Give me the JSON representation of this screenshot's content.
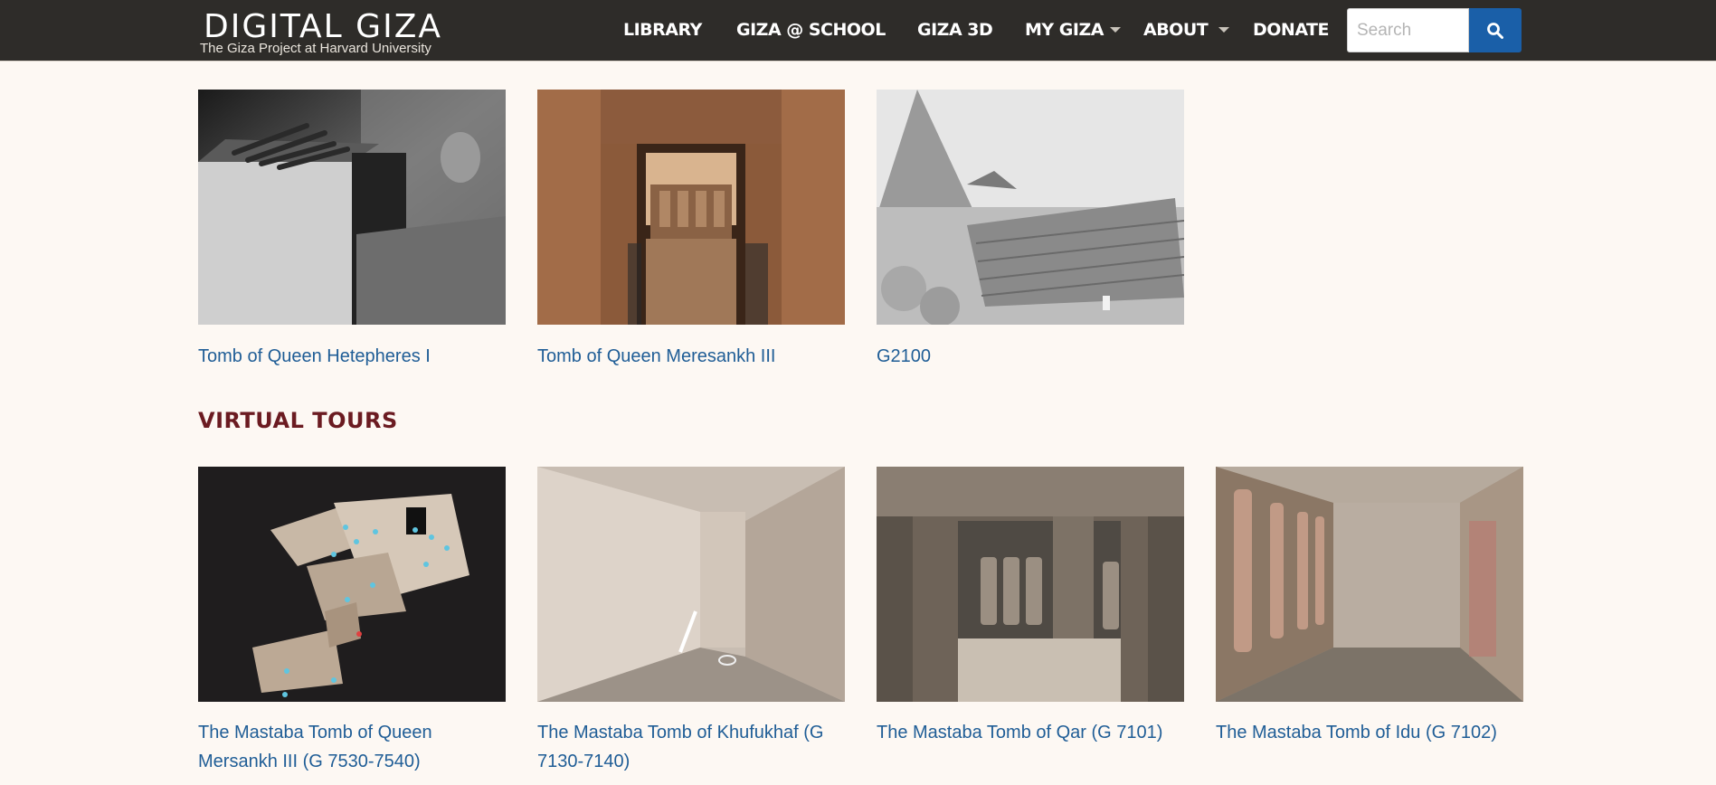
{
  "header": {
    "logo_title": "DIGITAL GIZA",
    "logo_subtitle": "The Giza Project at Harvard University",
    "nav": {
      "library": "LIBRARY",
      "school": "GIZA @ SCHOOL",
      "giza3d": "GIZA 3D",
      "mygiza": "MY GIZA",
      "about": "ABOUT",
      "donate": "DONATE"
    },
    "search": {
      "placeholder": "Search",
      "value": ""
    }
  },
  "tombs": {
    "items": [
      {
        "title": "Tomb of Queen Hetepheres I"
      },
      {
        "title": "Tomb of Queen Meresankh III"
      },
      {
        "title": "G2100"
      }
    ]
  },
  "virtual_tours": {
    "heading": "VIRTUAL TOURS",
    "items": [
      {
        "title": "The Mastaba Tomb of Queen Mersankh III (G 7530-7540)"
      },
      {
        "title": "The Mastaba Tomb of Khufukhaf (G 7130-7140)"
      },
      {
        "title": "The Mastaba Tomb of Qar (G 7101)"
      },
      {
        "title": "The Mastaba Tomb of Idu (G 7102)"
      }
    ]
  },
  "colors": {
    "header_bg": "#2e2c29",
    "page_bg": "#fdf8f3",
    "link": "#1f5d96",
    "heading": "#6b1b21",
    "search_button": "#1a5fa8"
  }
}
